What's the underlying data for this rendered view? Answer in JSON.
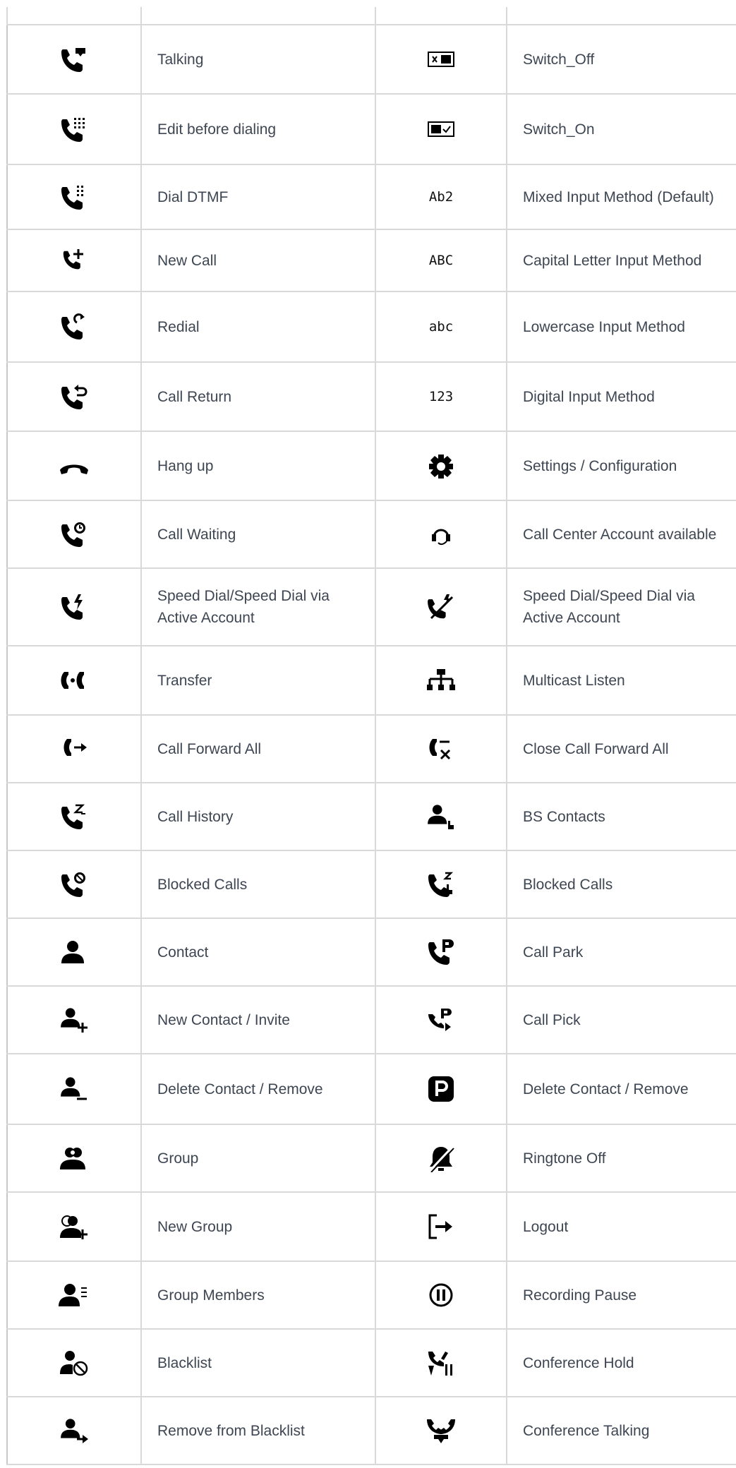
{
  "rows": [
    {
      "left_icon": "talking-icon",
      "left_label": "Talking",
      "right_icon": "switch-off-icon",
      "right_label": "Switch_Off"
    },
    {
      "left_icon": "edit-before-dialing-icon",
      "left_label": "Edit before dialing",
      "right_icon": "switch-on-icon",
      "right_label": "Switch_On"
    },
    {
      "left_icon": "dial-dtmf-icon",
      "left_label": "Dial DTMF",
      "right_icon": "mixed-input-icon",
      "right_label": "Mixed Input Method (Default)",
      "right_text": "Ab2"
    },
    {
      "left_icon": "new-call-icon",
      "left_label": "New Call",
      "right_icon": "capital-input-icon",
      "right_label": "Capital Letter Input Method",
      "right_text": "ABC"
    },
    {
      "left_icon": "redial-icon",
      "left_label": "Redial",
      "right_icon": "lowercase-input-icon",
      "right_label": "Lowercase Input Method",
      "right_text": "abc"
    },
    {
      "left_icon": "call-return-icon",
      "left_label": "Call Return",
      "right_icon": "digital-input-icon",
      "right_label": "Digital Input Method",
      "right_text": "123"
    },
    {
      "left_icon": "hang-up-icon",
      "left_label": "Hang up",
      "right_icon": "settings-icon",
      "right_label": "Settings / Configuration"
    },
    {
      "left_icon": "call-waiting-icon",
      "left_label": "Call Waiting",
      "right_icon": "call-center-icon",
      "right_label": "Call Center Account available"
    },
    {
      "left_icon": "speed-dial-icon",
      "left_label": "Speed Dial/Speed Dial via Active Account",
      "right_icon": "speed-dial-alt-icon",
      "right_label": "Speed Dial/Speed Dial via Active Account"
    },
    {
      "left_icon": "transfer-icon",
      "left_label": "Transfer",
      "right_icon": "multicast-listen-icon",
      "right_label": "Multicast Listen"
    },
    {
      "left_icon": "call-forward-all-icon",
      "left_label": "Call Forward All",
      "right_icon": "close-call-forward-icon",
      "right_label": "Close Call Forward All"
    },
    {
      "left_icon": "call-history-icon",
      "left_label": "Call History",
      "right_icon": "bs-contacts-icon",
      "right_label": "BS Contacts"
    },
    {
      "left_icon": "blocked-calls-icon",
      "left_label": "Blocked Calls",
      "right_icon": "blocked-calls-alt-icon",
      "right_label": "Blocked Calls"
    },
    {
      "left_icon": "contact-icon",
      "left_label": "Contact",
      "right_icon": "call-park-icon",
      "right_label": "Call Park"
    },
    {
      "left_icon": "new-contact-icon",
      "left_label": "New Contact / Invite",
      "right_icon": "call-pick-icon",
      "right_label": "Call Pick"
    },
    {
      "left_icon": "delete-contact-icon",
      "left_label": "Delete Contact / Remove",
      "right_icon": "park-badge-icon",
      "right_label": "Delete Contact / Remove"
    },
    {
      "left_icon": "group-icon",
      "left_label": "Group",
      "right_icon": "ringtone-off-icon",
      "right_label": "Ringtone Off"
    },
    {
      "left_icon": "new-group-icon",
      "left_label": "New Group",
      "right_icon": "logout-icon",
      "right_label": "Logout"
    },
    {
      "left_icon": "group-members-icon",
      "left_label": "Group Members",
      "right_icon": "recording-pause-icon",
      "right_label": "Recording Pause"
    },
    {
      "left_icon": "blacklist-icon",
      "left_label": "Blacklist",
      "right_icon": "conference-hold-icon",
      "right_label": "Conference Hold"
    },
    {
      "left_icon": "remove-blacklist-icon",
      "left_label": "Remove from Blacklist",
      "right_icon": "conference-talking-icon",
      "right_label": "Conference Talking"
    }
  ]
}
